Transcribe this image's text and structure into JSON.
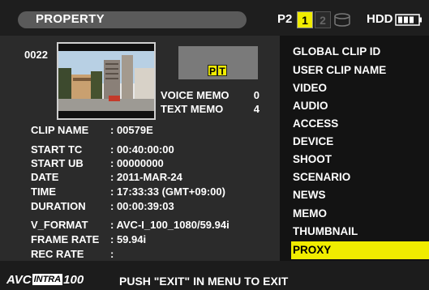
{
  "header": {
    "title": "PROPERTY",
    "media_label": "P2",
    "slot1": "1",
    "slot2": "2",
    "hdd_label": "HDD",
    "icons": {
      "disk": "disk-icon",
      "battery": "battery-icon"
    }
  },
  "clip": {
    "number": "0022",
    "memo_flags": [
      "P",
      "T"
    ],
    "voice_memo_label": "VOICE MEMO",
    "voice_memo_value": "0",
    "text_memo_label": "TEXT MEMO",
    "text_memo_value": "4"
  },
  "properties": [
    {
      "label": "CLIP NAME",
      "value": ": 00579E"
    },
    {
      "label": "START TC",
      "value": ": 00:40:00:00"
    },
    {
      "label": "START UB",
      "value": ": 00000000"
    },
    {
      "label": "DATE",
      "value": ": 2011-MAR-24"
    },
    {
      "label": "TIME",
      "value": ": 17:33:33 (GMT+09:00)"
    },
    {
      "label": "DURATION",
      "value": ": 00:00:39:03"
    },
    {
      "label": "V_FORMAT",
      "value": ": AVC-I_100_1080/59.94i"
    },
    {
      "label": "FRAME RATE",
      "value": ": 59.94i"
    },
    {
      "label": "REC RATE",
      "value": ":"
    }
  ],
  "menu": {
    "items": [
      "GLOBAL CLIP ID",
      "USER CLIP NAME",
      "VIDEO",
      "AUDIO",
      "ACCESS",
      "DEVICE",
      "SHOOT",
      "SCENARIO",
      "NEWS",
      "MEMO",
      "THUMBNAIL",
      "PROXY"
    ],
    "selected": "PROXY",
    "highlight_color": "#f0ec00"
  },
  "footer": {
    "logo_avc": "AVC",
    "logo_intra": "INTRA",
    "logo_num": "100",
    "message": "PUSH \"EXIT\" IN MENU TO EXIT"
  }
}
